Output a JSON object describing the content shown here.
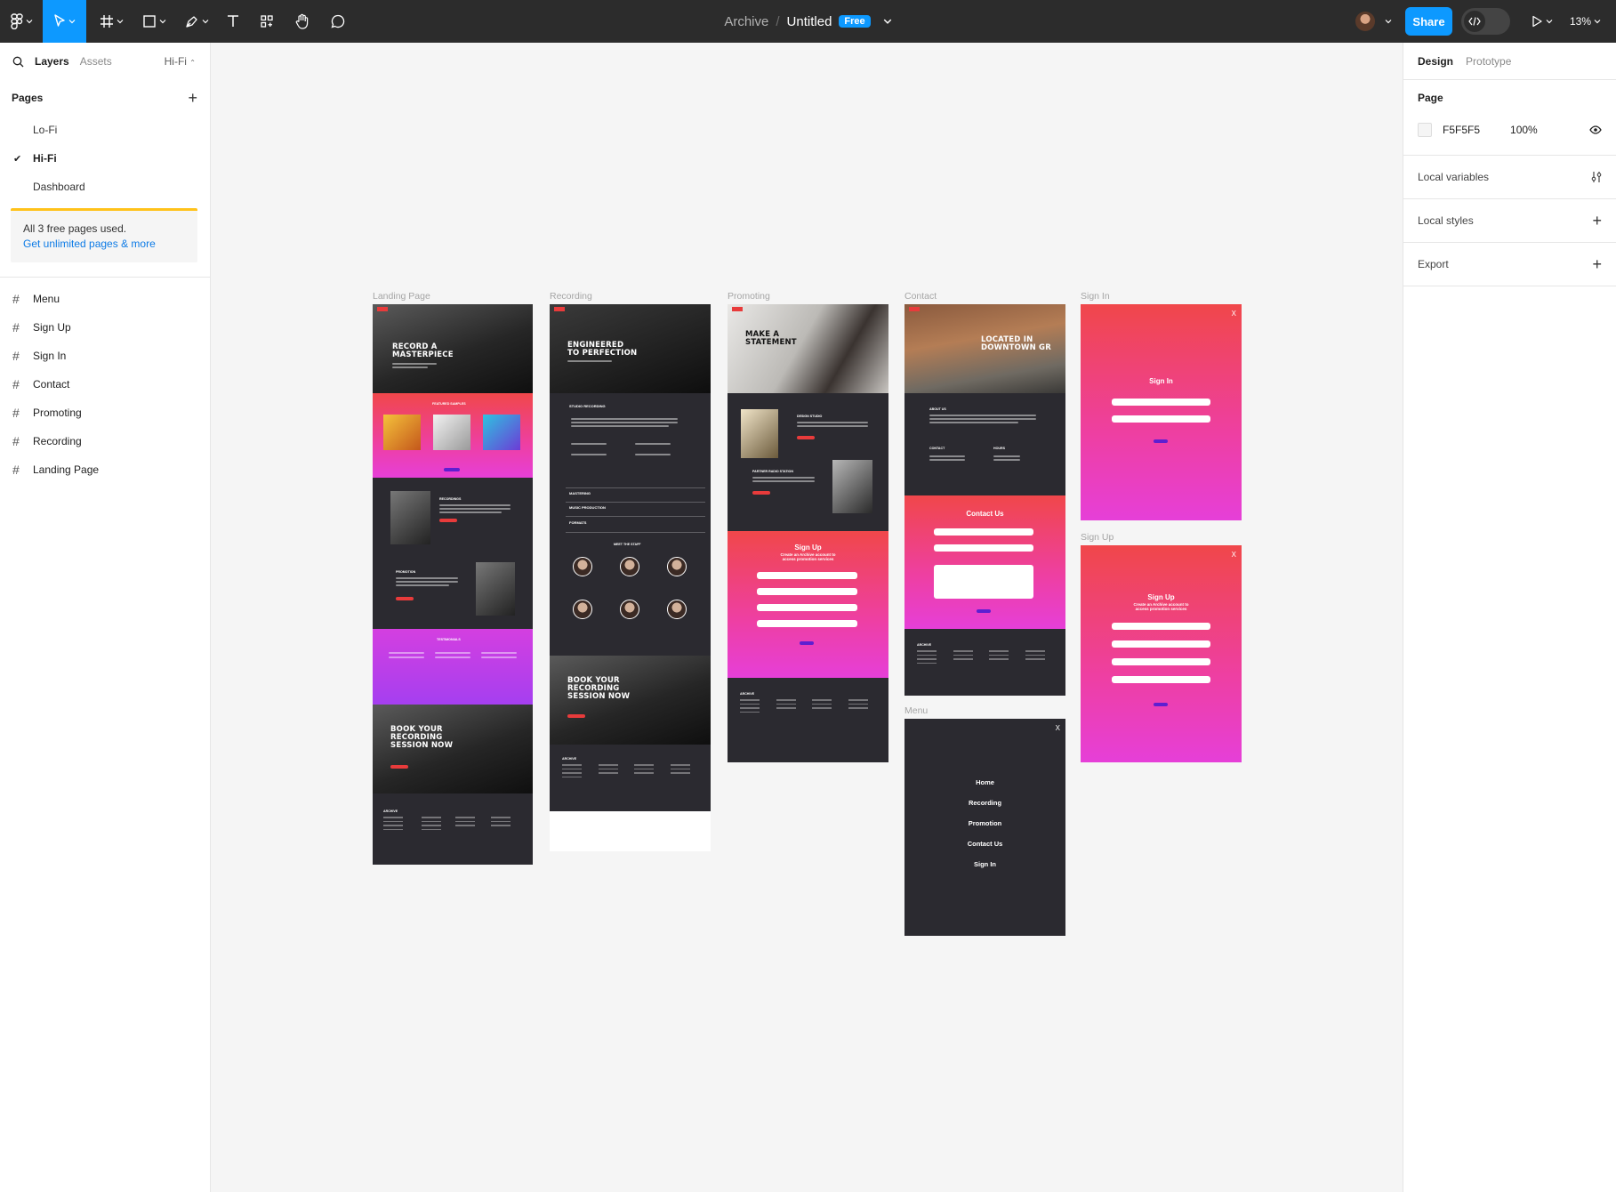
{
  "toolbar": {
    "doc_parent": "Archive",
    "separator": "/",
    "doc_name": "Untitled",
    "plan_badge": "Free",
    "share_label": "Share",
    "zoom_level": "13%"
  },
  "left_panel": {
    "tabs": {
      "layers": "Layers",
      "assets": "Assets"
    },
    "current_page": "Hi-Fi",
    "pages_header": "Pages",
    "pages": [
      {
        "label": "Lo-Fi",
        "selected": false
      },
      {
        "label": "Hi-Fi",
        "selected": true
      },
      {
        "label": "Dashboard",
        "selected": false
      }
    ],
    "upgrade": {
      "message": "All 3 free pages used.",
      "link": "Get unlimited pages & more"
    },
    "layers": [
      "Menu",
      "Sign Up",
      "Sign In",
      "Contact",
      "Promoting",
      "Recording",
      "Landing Page"
    ]
  },
  "right_panel": {
    "tabs": {
      "design": "Design",
      "prototype": "Prototype"
    },
    "page_section": "Page",
    "fill_hex": "F5F5F5",
    "fill_opacity": "100%",
    "rows": [
      "Local variables",
      "Local styles",
      "Export"
    ]
  },
  "canvas": {
    "frames": {
      "landing": {
        "label": "Landing Page",
        "hero_line1": "RECORD A",
        "hero_line2": "MASTERPIECE",
        "samples_title": "FEATURED SAMPLES",
        "recordings_title": "RECORDINGS",
        "promotion_title": "PROMOTION",
        "testimonials_title": "TESTIMONIALS",
        "book_line1": "BOOK YOUR",
        "book_line2": "RECORDING",
        "book_line3": "SESSION NOW",
        "footer_logo": "ARCHIVE"
      },
      "recording": {
        "label": "Recording",
        "hero_line1": "ENGINEERED",
        "hero_line2": "TO PERFECTION",
        "acc1": "STUDIO RECORDING",
        "acc2": "MASTERING",
        "acc3": "MUSIC PRODUCTION",
        "acc4": "FORMATS",
        "staff_title": "MEET THE STAFF",
        "book_line1": "BOOK YOUR",
        "book_line2": "RECORDING",
        "book_line3": "SESSION NOW",
        "footer_logo": "ARCHIVE"
      },
      "promoting": {
        "label": "Promoting",
        "hero_line1": "MAKE A",
        "hero_line2": "STATEMENT",
        "design_title": "DESIGN STUDIO",
        "radio_title": "PARTNER RADIO STATION",
        "signup_title": "Sign Up",
        "signup_sub1": "Create an Archive account to",
        "signup_sub2": "access promotion services",
        "footer_logo": "ARCHIVE"
      },
      "contact": {
        "label": "Contact",
        "hero_line1": "LOCATED IN",
        "hero_line2": "DOWNTOWN GR",
        "about_title": "ABOUT US",
        "contact_title": "CONTACT",
        "hours_title": "HOURS",
        "form_title": "Contact Us",
        "footer_logo": "ARCHIVE"
      },
      "signin": {
        "label": "Sign In",
        "title": "Sign In",
        "close": "X"
      },
      "signup": {
        "label": "Sign Up",
        "title": "Sign Up",
        "sub1": "Create an Archive account to",
        "sub2": "access promotion services",
        "close": "X"
      },
      "menu": {
        "label": "Menu",
        "close": "X",
        "items": [
          "Home",
          "Recording",
          "Promotion",
          "Contact Us",
          "Sign In"
        ]
      }
    }
  }
}
